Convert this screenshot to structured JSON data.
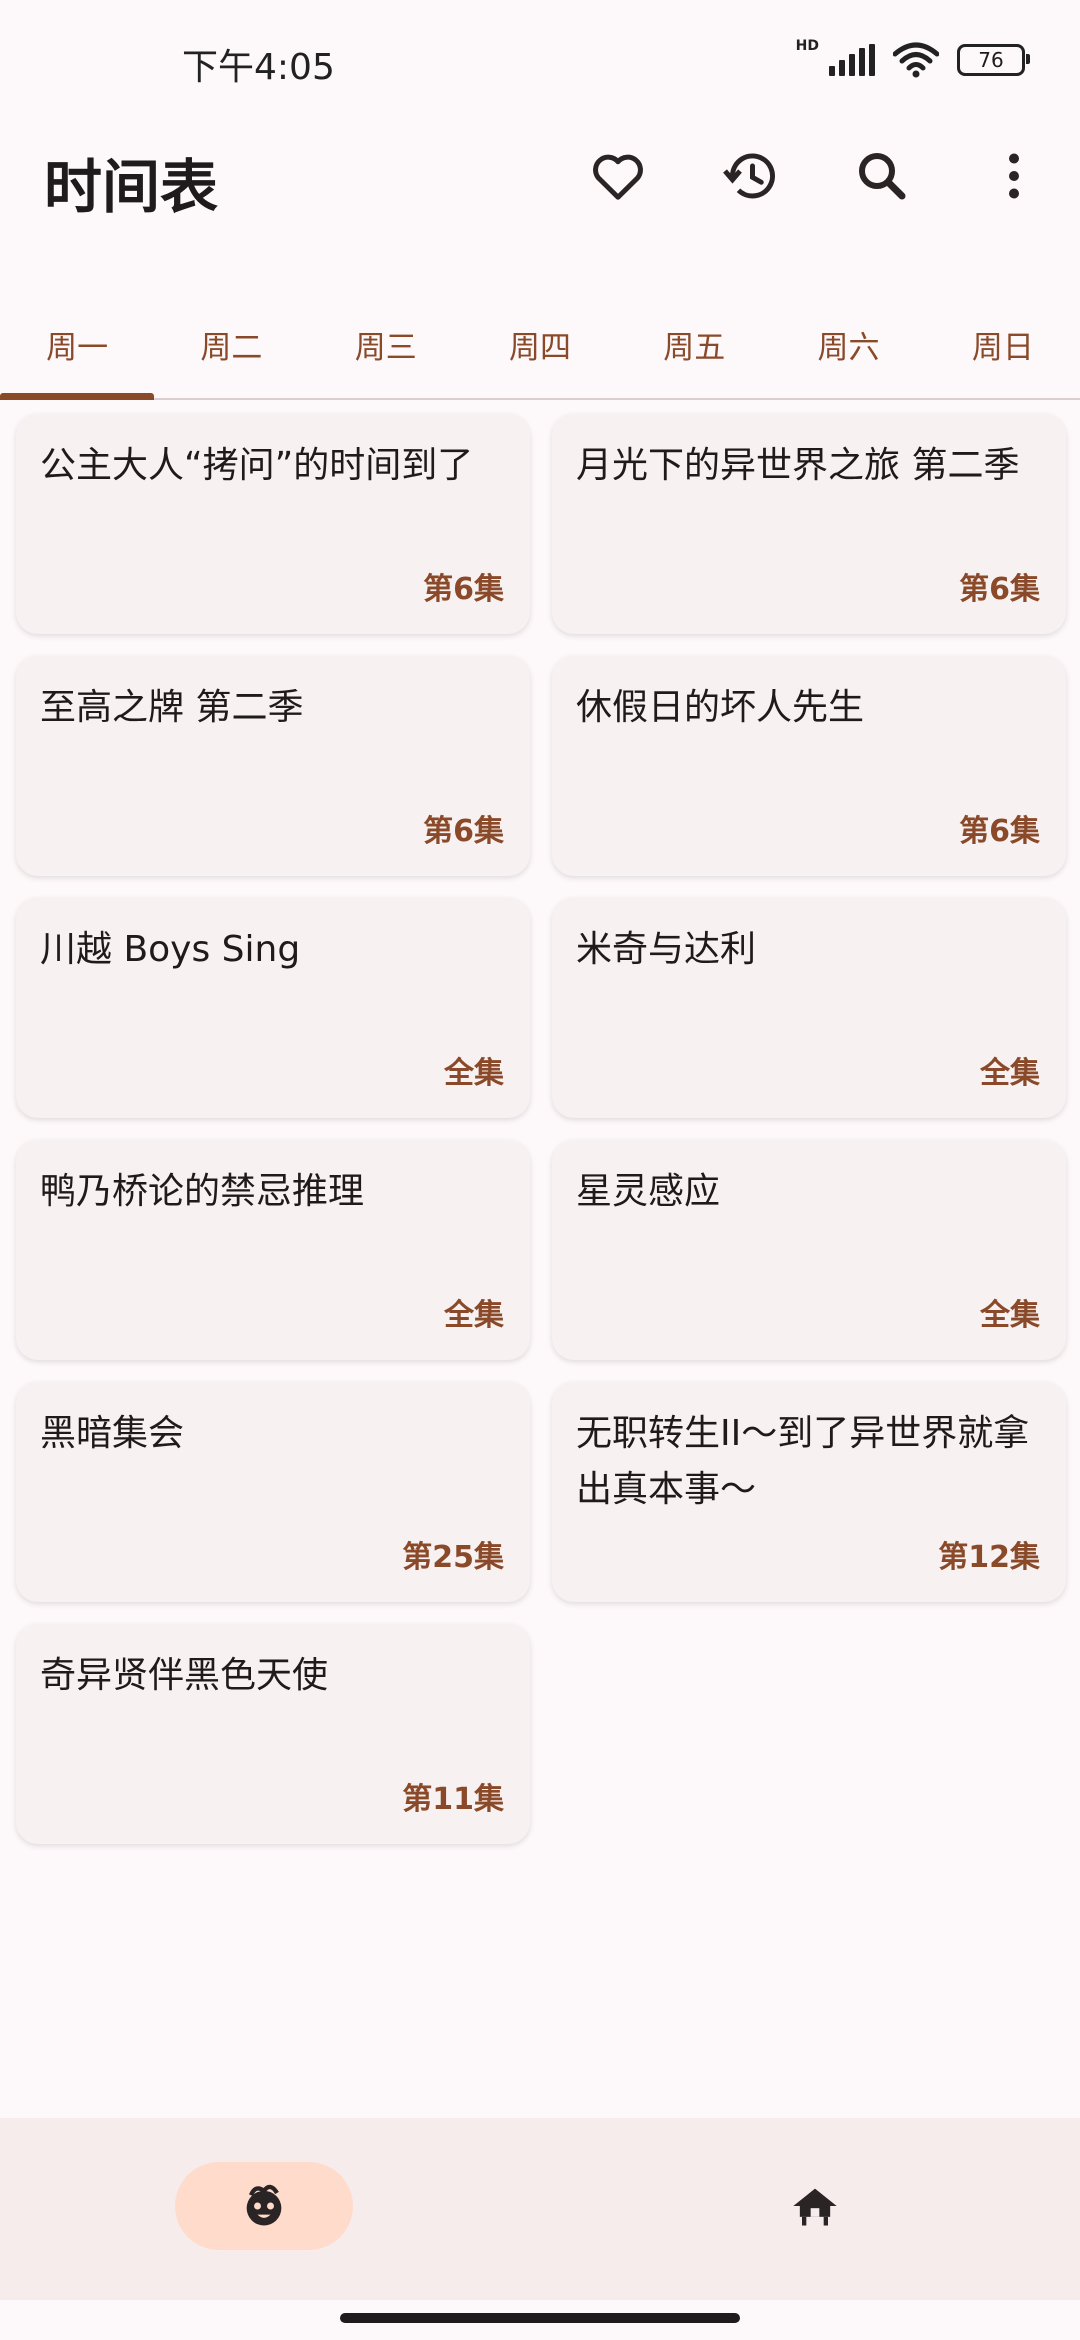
{
  "status_bar": {
    "time": "下午4:05",
    "hd": "HD",
    "battery": "76"
  },
  "app_bar": {
    "title": "时间表",
    "actions": [
      "heart-icon",
      "history-icon",
      "search-icon",
      "more-vert-icon"
    ]
  },
  "tabs": [
    {
      "label": "周一",
      "active": true
    },
    {
      "label": "周二"
    },
    {
      "label": "周三"
    },
    {
      "label": "周四"
    },
    {
      "label": "周五"
    },
    {
      "label": "周六"
    },
    {
      "label": "周日"
    }
  ],
  "cards": [
    {
      "title": "公主大人“拷问”的时间到了",
      "episode": "第6集"
    },
    {
      "title": "月光下的异世界之旅 第二季",
      "episode": "第6集"
    },
    {
      "title": "至高之牌 第二季",
      "episode": "第6集"
    },
    {
      "title": "休假日的坏人先生",
      "episode": "第6集"
    },
    {
      "title": "川越 Boys Sing",
      "episode": "全集"
    },
    {
      "title": "米奇与达利",
      "episode": "全集"
    },
    {
      "title": "鸭乃桥论的禁忌推理",
      "episode": "全集"
    },
    {
      "title": "星灵感应",
      "episode": "全集"
    },
    {
      "title": "黑暗集会",
      "episode": "第25集"
    },
    {
      "title": "无职转生II～到了异世界就拿出真本事～",
      "episode": "第12集"
    },
    {
      "title": "奇异贤伴黑色天使",
      "episode": "第11集"
    }
  ],
  "bottom_nav": [
    {
      "icon": "anime-face-icon",
      "active": true
    },
    {
      "icon": "home-icon",
      "active": false
    }
  ],
  "colors": {
    "accent": "#8a4a2a",
    "background": "#fdf8fa",
    "card": "#f7f1f1",
    "nav_active": "#ffdbcc"
  }
}
